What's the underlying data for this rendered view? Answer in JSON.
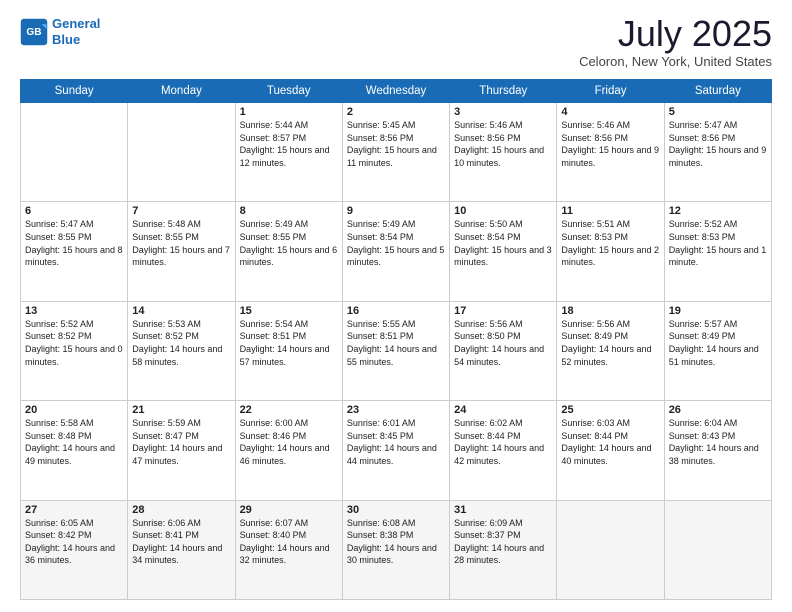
{
  "header": {
    "logo_line1": "General",
    "logo_line2": "Blue",
    "title": "July 2025",
    "subtitle": "Celoron, New York, United States"
  },
  "weekdays": [
    "Sunday",
    "Monday",
    "Tuesday",
    "Wednesday",
    "Thursday",
    "Friday",
    "Saturday"
  ],
  "weeks": [
    [
      {
        "day": "",
        "info": ""
      },
      {
        "day": "",
        "info": ""
      },
      {
        "day": "1",
        "info": "Sunrise: 5:44 AM\nSunset: 8:57 PM\nDaylight: 15 hours and 12 minutes."
      },
      {
        "day": "2",
        "info": "Sunrise: 5:45 AM\nSunset: 8:56 PM\nDaylight: 15 hours and 11 minutes."
      },
      {
        "day": "3",
        "info": "Sunrise: 5:46 AM\nSunset: 8:56 PM\nDaylight: 15 hours and 10 minutes."
      },
      {
        "day": "4",
        "info": "Sunrise: 5:46 AM\nSunset: 8:56 PM\nDaylight: 15 hours and 9 minutes."
      },
      {
        "day": "5",
        "info": "Sunrise: 5:47 AM\nSunset: 8:56 PM\nDaylight: 15 hours and 9 minutes."
      }
    ],
    [
      {
        "day": "6",
        "info": "Sunrise: 5:47 AM\nSunset: 8:55 PM\nDaylight: 15 hours and 8 minutes."
      },
      {
        "day": "7",
        "info": "Sunrise: 5:48 AM\nSunset: 8:55 PM\nDaylight: 15 hours and 7 minutes."
      },
      {
        "day": "8",
        "info": "Sunrise: 5:49 AM\nSunset: 8:55 PM\nDaylight: 15 hours and 6 minutes."
      },
      {
        "day": "9",
        "info": "Sunrise: 5:49 AM\nSunset: 8:54 PM\nDaylight: 15 hours and 5 minutes."
      },
      {
        "day": "10",
        "info": "Sunrise: 5:50 AM\nSunset: 8:54 PM\nDaylight: 15 hours and 3 minutes."
      },
      {
        "day": "11",
        "info": "Sunrise: 5:51 AM\nSunset: 8:53 PM\nDaylight: 15 hours and 2 minutes."
      },
      {
        "day": "12",
        "info": "Sunrise: 5:52 AM\nSunset: 8:53 PM\nDaylight: 15 hours and 1 minute."
      }
    ],
    [
      {
        "day": "13",
        "info": "Sunrise: 5:52 AM\nSunset: 8:52 PM\nDaylight: 15 hours and 0 minutes."
      },
      {
        "day": "14",
        "info": "Sunrise: 5:53 AM\nSunset: 8:52 PM\nDaylight: 14 hours and 58 minutes."
      },
      {
        "day": "15",
        "info": "Sunrise: 5:54 AM\nSunset: 8:51 PM\nDaylight: 14 hours and 57 minutes."
      },
      {
        "day": "16",
        "info": "Sunrise: 5:55 AM\nSunset: 8:51 PM\nDaylight: 14 hours and 55 minutes."
      },
      {
        "day": "17",
        "info": "Sunrise: 5:56 AM\nSunset: 8:50 PM\nDaylight: 14 hours and 54 minutes."
      },
      {
        "day": "18",
        "info": "Sunrise: 5:56 AM\nSunset: 8:49 PM\nDaylight: 14 hours and 52 minutes."
      },
      {
        "day": "19",
        "info": "Sunrise: 5:57 AM\nSunset: 8:49 PM\nDaylight: 14 hours and 51 minutes."
      }
    ],
    [
      {
        "day": "20",
        "info": "Sunrise: 5:58 AM\nSunset: 8:48 PM\nDaylight: 14 hours and 49 minutes."
      },
      {
        "day": "21",
        "info": "Sunrise: 5:59 AM\nSunset: 8:47 PM\nDaylight: 14 hours and 47 minutes."
      },
      {
        "day": "22",
        "info": "Sunrise: 6:00 AM\nSunset: 8:46 PM\nDaylight: 14 hours and 46 minutes."
      },
      {
        "day": "23",
        "info": "Sunrise: 6:01 AM\nSunset: 8:45 PM\nDaylight: 14 hours and 44 minutes."
      },
      {
        "day": "24",
        "info": "Sunrise: 6:02 AM\nSunset: 8:44 PM\nDaylight: 14 hours and 42 minutes."
      },
      {
        "day": "25",
        "info": "Sunrise: 6:03 AM\nSunset: 8:44 PM\nDaylight: 14 hours and 40 minutes."
      },
      {
        "day": "26",
        "info": "Sunrise: 6:04 AM\nSunset: 8:43 PM\nDaylight: 14 hours and 38 minutes."
      }
    ],
    [
      {
        "day": "27",
        "info": "Sunrise: 6:05 AM\nSunset: 8:42 PM\nDaylight: 14 hours and 36 minutes."
      },
      {
        "day": "28",
        "info": "Sunrise: 6:06 AM\nSunset: 8:41 PM\nDaylight: 14 hours and 34 minutes."
      },
      {
        "day": "29",
        "info": "Sunrise: 6:07 AM\nSunset: 8:40 PM\nDaylight: 14 hours and 32 minutes."
      },
      {
        "day": "30",
        "info": "Sunrise: 6:08 AM\nSunset: 8:38 PM\nDaylight: 14 hours and 30 minutes."
      },
      {
        "day": "31",
        "info": "Sunrise: 6:09 AM\nSunset: 8:37 PM\nDaylight: 14 hours and 28 minutes."
      },
      {
        "day": "",
        "info": ""
      },
      {
        "day": "",
        "info": ""
      }
    ]
  ]
}
